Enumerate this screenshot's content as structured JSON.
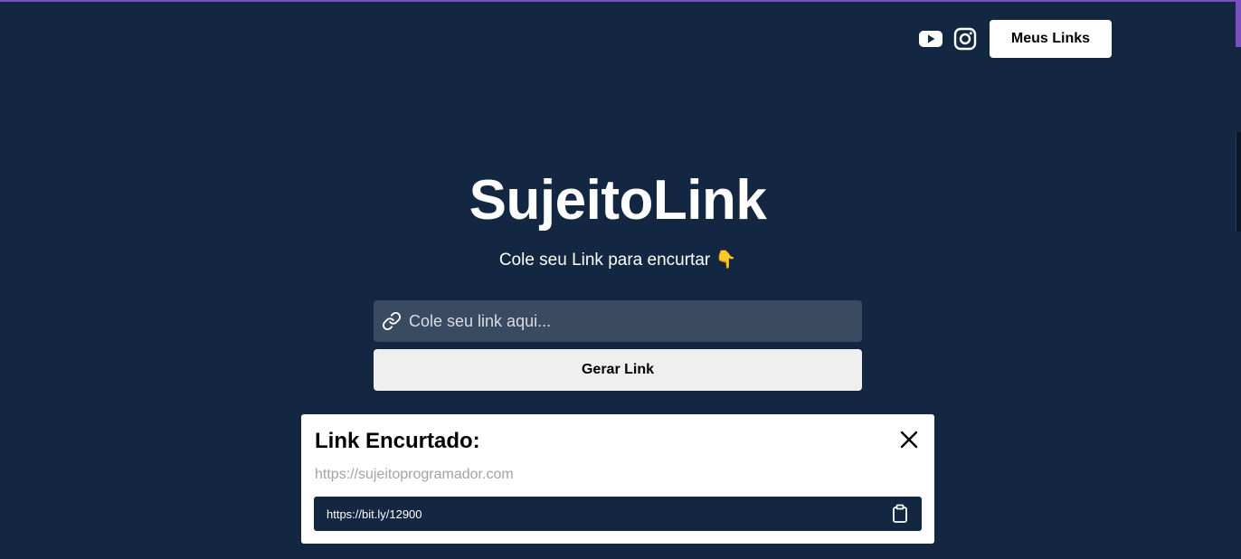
{
  "header": {
    "social_icons": [
      "youtube-icon",
      "instagram-icon"
    ],
    "my_links_label": "Meus Links"
  },
  "hero": {
    "logo": "SujeitoLink",
    "subtitle": "Cole seu Link para encurtar 👇"
  },
  "form": {
    "input_icon": "link-icon",
    "placeholder": "Cole seu link aqui...",
    "value": "",
    "generate_label": "Gerar Link"
  },
  "modal": {
    "title": "Link Encurtado:",
    "original_url": "https://sujeitoprogramador.com",
    "short_url": "https://bit.ly/12900",
    "close_icon": "close-icon",
    "copy_icon": "clipboard-icon"
  },
  "colors": {
    "background": "#132742",
    "accent": "#7b4fc4",
    "input_bg": "#3a4a60",
    "button_bg": "#efefef",
    "muted_text": "#a3a3a3"
  }
}
